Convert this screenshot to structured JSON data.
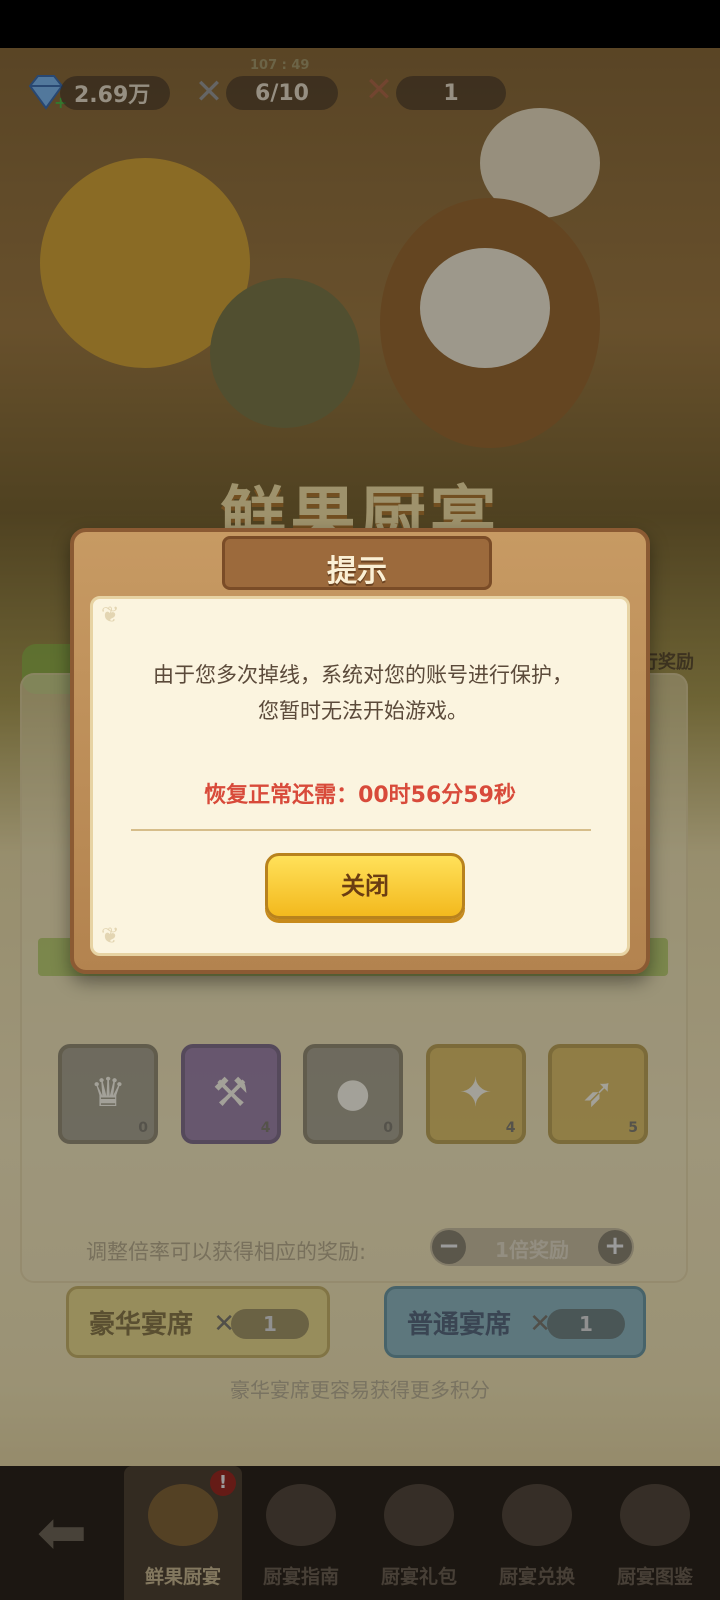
{
  "top_bar": {
    "diamonds": "2.69万",
    "stamina_timer": "107 : 49",
    "stamina": "6/10",
    "tickets": "1"
  },
  "scene": {
    "title_art": "鲜果厨宴"
  },
  "background_ui": {
    "side_label": "行奖励",
    "items": [
      {
        "count": "0",
        "style": "gray",
        "icon": "chef-hat-icon"
      },
      {
        "count": "4",
        "style": "purple",
        "icon": "hammer-icon"
      },
      {
        "count": "0",
        "style": "gray",
        "icon": "cat-bomb-icon"
      },
      {
        "count": "4",
        "style": "gold",
        "icon": "ticket-icon"
      },
      {
        "count": "5",
        "style": "gold",
        "icon": "horn-icon"
      }
    ],
    "hint": "调整倍率可以获得相应的奖励:",
    "multiplier": "1倍奖励",
    "luxury_seat": {
      "label": "豪华宴席",
      "count": "1"
    },
    "normal_seat": {
      "label": "普通宴席",
      "count": "1"
    },
    "footer_note": "豪华宴席更容易获得更多积分"
  },
  "bottom_nav": {
    "badge": "!",
    "items": [
      {
        "label": "鲜果厨宴",
        "active": true
      },
      {
        "label": "厨宴指南",
        "active": false
      },
      {
        "label": "厨宴礼包",
        "active": false
      },
      {
        "label": "厨宴兑换",
        "active": false
      },
      {
        "label": "厨宴图鉴",
        "active": false
      }
    ]
  },
  "dialog": {
    "title": "提示",
    "message_line1": "由于您多次掉线，系统对您的账号进行保护，",
    "message_line2": "您暂时无法开始游戏。",
    "timer_text": "恢复正常还需：00时56分59秒",
    "close_label": "关闭"
  },
  "colors": {
    "dialog_frame": "#b3834f",
    "timer_red": "#d84a3a",
    "close_button": "#f3b91e"
  }
}
